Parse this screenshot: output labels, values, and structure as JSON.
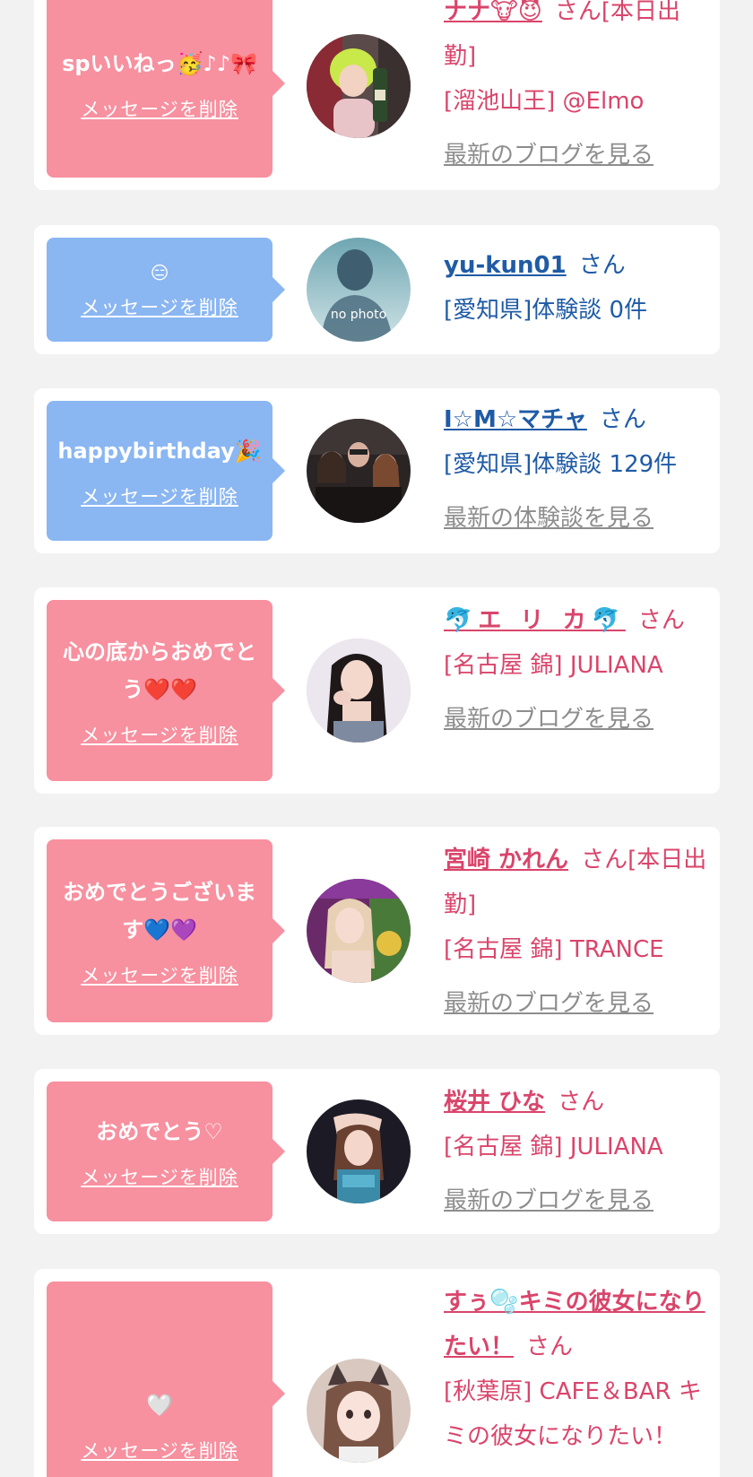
{
  "delete_label": "メッセージを削除",
  "san_label": "さん",
  "colors": {
    "background": "#f2f2f2",
    "bubble_pink": "#f7909f",
    "bubble_blue": "#8ab6f2",
    "name_pink": "#d9456b",
    "name_blue": "#1f5ba6",
    "link_gray": "#8d8d8d"
  },
  "messages": [
    {
      "bubble_text": "spいいねっ🥳♪♪🎀",
      "bubble_color": "pink",
      "name": "ナナ🐮😈",
      "name_suffix": "[本日出勤]",
      "area_shop": "[溜池山王] @Elmo",
      "link": "最新のブログを見る",
      "avatar": "avatar-green-hair"
    },
    {
      "bubble_text": "😑",
      "bubble_color": "blue",
      "name": "yu-kun01",
      "name_suffix": "",
      "area_shop": "[愛知県]体験談 0件",
      "link": "",
      "avatar": "no-photo-silhouette",
      "avatar_caption": "no photo"
    },
    {
      "bubble_text": "happybirthday🎉",
      "bubble_color": "blue",
      "name": "I☆M☆マチャ",
      "name_suffix": "",
      "area_shop": "[愛知県]体験談 129件",
      "link": "最新の体験談を見る",
      "avatar": "avatar-group-photo"
    },
    {
      "bubble_text": "心の底からおめでとう❤️❤️",
      "bubble_color": "pink",
      "name": "🐬エ リ カ🐬",
      "name_suffix": "",
      "area_shop": "[名古屋 錦] JULIANA",
      "link": "最新のブログを見る",
      "avatar": "avatar-dark-hair"
    },
    {
      "bubble_text": "おめでとうございます💙💜",
      "bubble_color": "pink",
      "name": "宮崎 かれん",
      "name_suffix": "[本日出勤]",
      "area_shop": "[名古屋 錦] TRANCE",
      "link": "最新のブログを見る",
      "avatar": "avatar-blonde-hair"
    },
    {
      "bubble_text": "おめでとう♡",
      "bubble_color": "pink",
      "name": "桜井 ひな",
      "name_suffix": "",
      "area_shop": "[名古屋 錦] JULIANA",
      "link": "最新のブログを見る",
      "avatar": "avatar-night-photo"
    },
    {
      "bubble_text": "🤍",
      "bubble_color": "pink",
      "name": "すぅ🫧キミの彼女になりたい！",
      "name_suffix": "",
      "area_shop": "[秋葉原] CAFE＆BAR キミの彼女になりたい！",
      "link": "",
      "avatar": "avatar-cat-ears"
    }
  ]
}
